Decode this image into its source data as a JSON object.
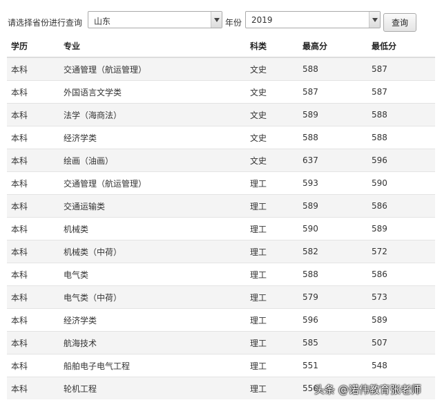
{
  "filter": {
    "province_label": "请选择省份进行查询",
    "province_value": "山东",
    "year_label": "年份",
    "year_value": "2019",
    "query_button": "查询"
  },
  "table": {
    "headers": [
      "学历",
      "专业",
      "科类",
      "最高分",
      "最低分"
    ],
    "rows": [
      [
        "本科",
        "交通管理（航运管理）",
        "文史",
        "588",
        "587"
      ],
      [
        "本科",
        "外国语言文学类",
        "文史",
        "587",
        "587"
      ],
      [
        "本科",
        "法学（海商法）",
        "文史",
        "589",
        "588"
      ],
      [
        "本科",
        "经济学类",
        "文史",
        "588",
        "588"
      ],
      [
        "本科",
        "绘画（油画）",
        "文史",
        "637",
        "596"
      ],
      [
        "本科",
        "交通管理（航运管理）",
        "理工",
        "593",
        "590"
      ],
      [
        "本科",
        "交通运输类",
        "理工",
        "589",
        "586"
      ],
      [
        "本科",
        "机械类",
        "理工",
        "590",
        "589"
      ],
      [
        "本科",
        "机械类（中荷）",
        "理工",
        "582",
        "572"
      ],
      [
        "本科",
        "电气类",
        "理工",
        "588",
        "586"
      ],
      [
        "本科",
        "电气类（中荷）",
        "理工",
        "579",
        "573"
      ],
      [
        "本科",
        "经济学类",
        "理工",
        "596",
        "589"
      ],
      [
        "本科",
        "航海技术",
        "理工",
        "585",
        "507"
      ],
      [
        "本科",
        "船舶电子电气工程",
        "理工",
        "551",
        "548"
      ],
      [
        "本科",
        "轮机工程",
        "理工",
        "556",
        ""
      ]
    ]
  },
  "watermark": "头条 @诺伟教育张老师"
}
